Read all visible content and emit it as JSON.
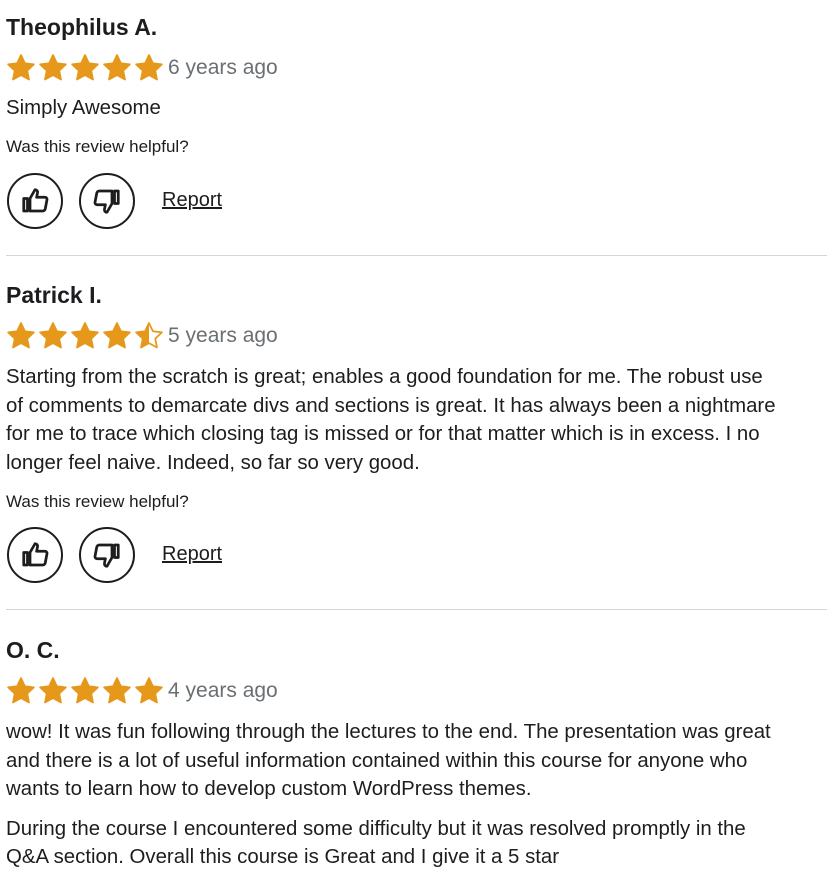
{
  "colors": {
    "star": "#e59819",
    "text": "#1c1d1f",
    "muted": "#6a6f73",
    "divider": "#d1d7dc"
  },
  "helpful_prompt": "Was this review helpful?",
  "report_label": "Report",
  "icons": {
    "like": "thumbs-up-icon",
    "dislike": "thumbs-down-icon",
    "star": "star-icon"
  },
  "reviews": [
    {
      "name": "Theophilus A.",
      "rating": 5,
      "time": "6 years ago",
      "paragraphs": [
        [
          "Simply Awesome"
        ]
      ]
    },
    {
      "name": "Patrick I.",
      "rating": 4.5,
      "time": "5 years ago",
      "paragraphs": [
        [
          "Starting from the scratch is great; enables a good foundation for me. The robust use",
          "of comments to demarcate divs and sections is great. It has always been a nightmare",
          "for me to trace which closing tag is missed or for that matter which is in excess. I no",
          "longer feel naive. Indeed, so far so very good."
        ]
      ]
    },
    {
      "name": "O. C.",
      "rating": 5,
      "time": "4 years ago",
      "paragraphs": [
        [
          "wow! It was fun following through the lectures to the end. The presentation was great",
          "and there is a lot of useful information contained within this course for anyone who",
          "wants to learn how to develop custom WordPress themes."
        ],
        [
          "During the course I encountered some difficulty but it was resolved promptly in the",
          "Q&A section. Overall this course is Great and I give it a 5 star"
        ]
      ]
    }
  ]
}
